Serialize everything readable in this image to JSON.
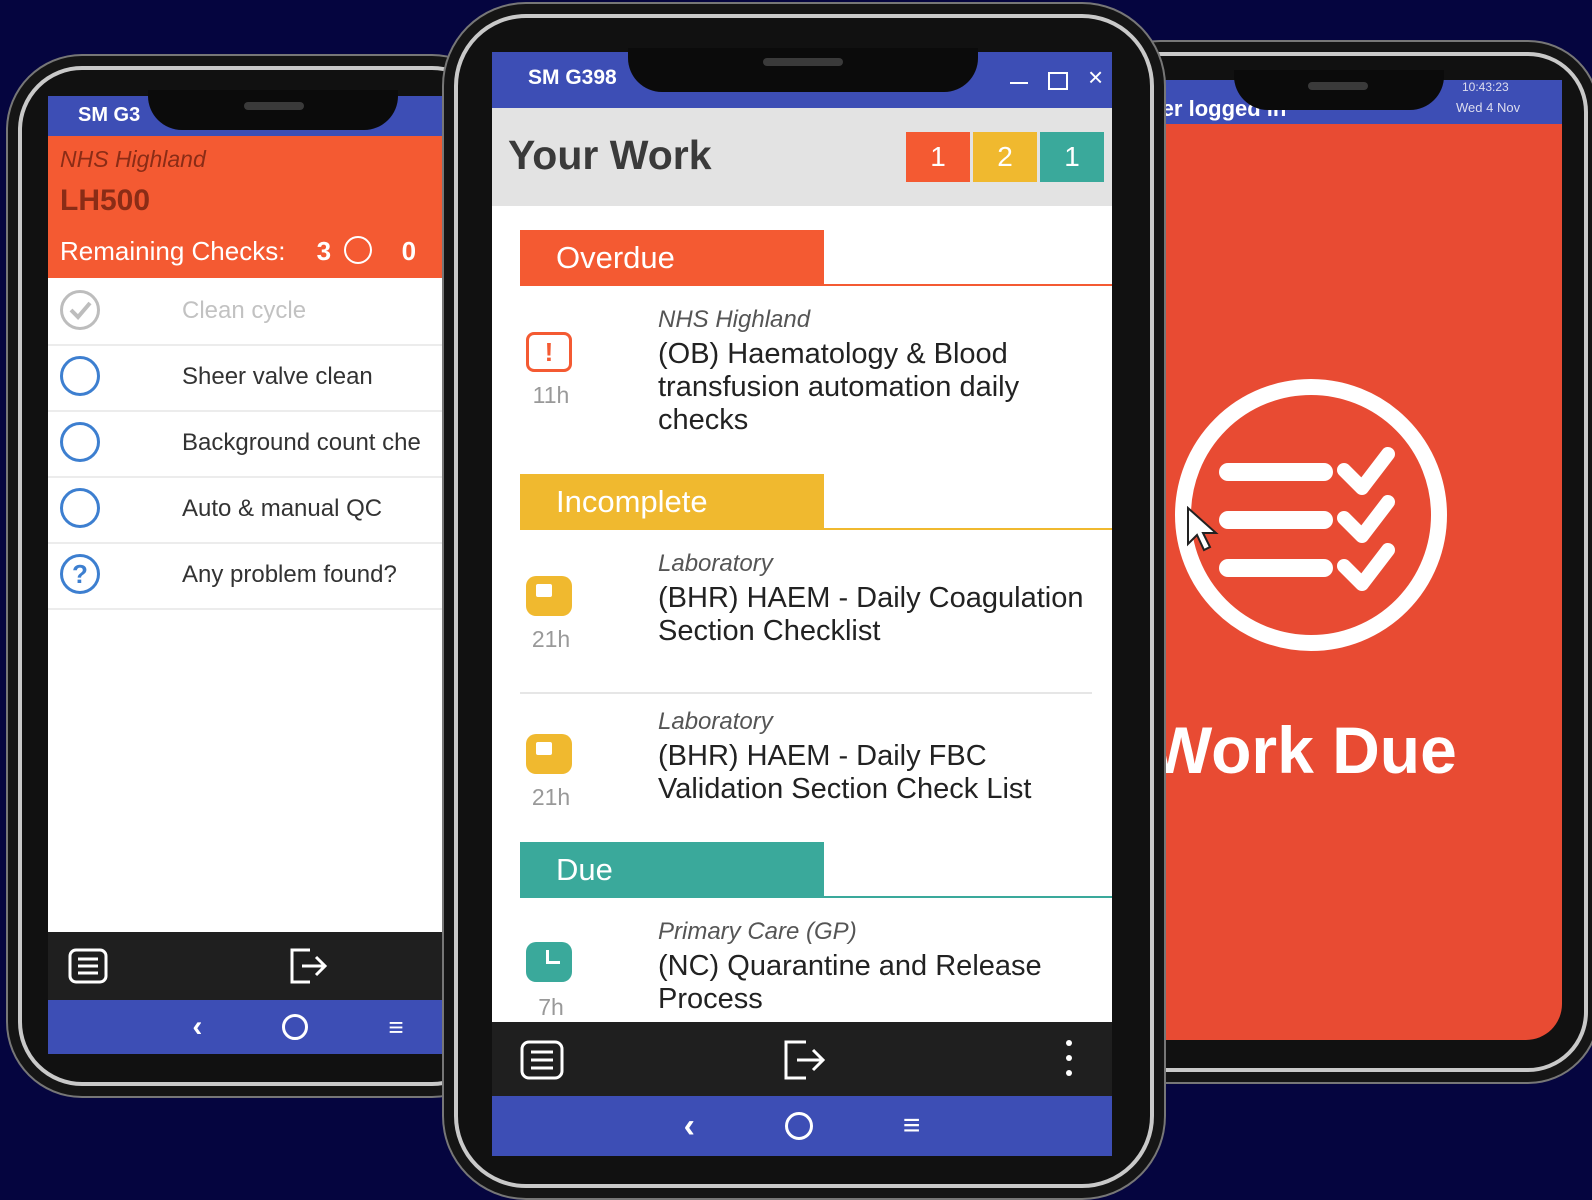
{
  "colors": {
    "background": "#05053f",
    "overdue": "#f45a32",
    "incomplete": "#f0b92f",
    "due": "#3aa99b",
    "nav": "#3d4eb5",
    "right_screen": "#e84b33"
  },
  "left_phone": {
    "status_text": "SM G3",
    "org": "NHS Highland",
    "device": "LH500",
    "remaining_label": "Remaining Checks:",
    "remaining_count": "3",
    "other_count": "0",
    "checks": [
      {
        "label": "Clean cycle",
        "state": "done",
        "icon": "check-circle-icon"
      },
      {
        "label": "Sheer valve clean",
        "state": "pending",
        "icon": "circle-icon"
      },
      {
        "label": "Background count che",
        "state": "pending",
        "icon": "circle-icon"
      },
      {
        "label": "Auto & manual QC",
        "state": "pending",
        "icon": "circle-icon"
      },
      {
        "label": "Any problem found?",
        "state": "question",
        "icon": "question-icon",
        "glyph": "?"
      }
    ],
    "bottom_icons": [
      "list-icon",
      "logout-icon"
    ],
    "nav_icons": [
      "back-icon",
      "home-icon",
      "menu-icon"
    ]
  },
  "center_phone": {
    "status_text": "SM G398",
    "window_controls": [
      "minimize-icon",
      "maximize-icon",
      "close-icon"
    ],
    "title": "Your Work",
    "badges": {
      "overdue": "1",
      "incomplete": "2",
      "due": "1"
    },
    "sections": {
      "overdue": {
        "label": "Overdue",
        "items": [
          {
            "category": "NHS Highland",
            "title": "(OB) Haematology & Blood transfusion automation daily checks",
            "age": "11h",
            "icon": "alert-icon",
            "glyph": "!"
          }
        ]
      },
      "incomplete": {
        "label": "Incomplete",
        "items": [
          {
            "category": "Laboratory",
            "title": "(BHR) HAEM - Daily Coagulation Section Checklist",
            "age": "21h",
            "icon": "partial-clock-icon"
          },
          {
            "category": "Laboratory",
            "title": "(BHR) HAEM - Daily FBC Validation Section Check List",
            "age": "21h",
            "icon": "partial-clock-icon"
          }
        ]
      },
      "due": {
        "label": "Due",
        "items": [
          {
            "category": "Primary Care (GP)",
            "title": "(NC) Quarantine and Release Process",
            "age": "7h",
            "icon": "clock-icon"
          }
        ]
      }
    },
    "bottom_icons": [
      "list-icon",
      "logout-icon",
      "more-vert-icon"
    ],
    "nav_icons": [
      "back-icon",
      "home-icon",
      "menu-icon"
    ]
  },
  "right_phone": {
    "status_left": "user logged in",
    "status_time": "10:43:23",
    "status_date": "Wed 4 Nov",
    "splash_text": "Work Due",
    "splash_icon": "checklist-icon"
  }
}
